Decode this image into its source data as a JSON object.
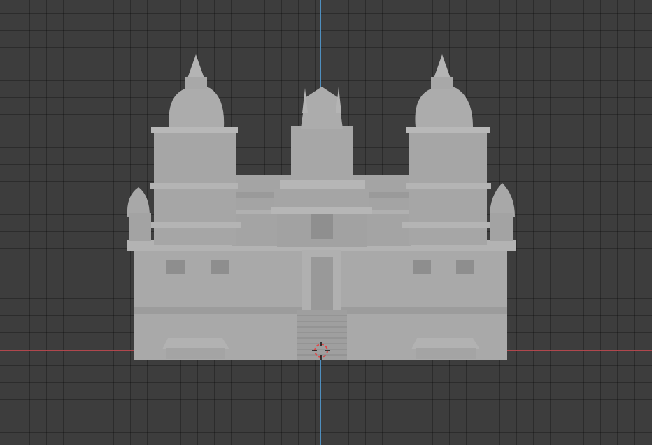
{
  "viewport": {
    "background": "#3d3d3d",
    "grid_color": "#2f2f2f",
    "x_axis_color": "#b0474d",
    "y_axis_color": "#4f8fbf"
  },
  "model": {
    "icon": "temple-mesh-icon",
    "color": "#a8a8a8",
    "shade_dark": "#8c8c8c",
    "shade_light": "#bdbdbd"
  },
  "cursor": {
    "icon": "3d-cursor-icon",
    "ring_color": "#e04848",
    "tick_color": "#111111"
  }
}
